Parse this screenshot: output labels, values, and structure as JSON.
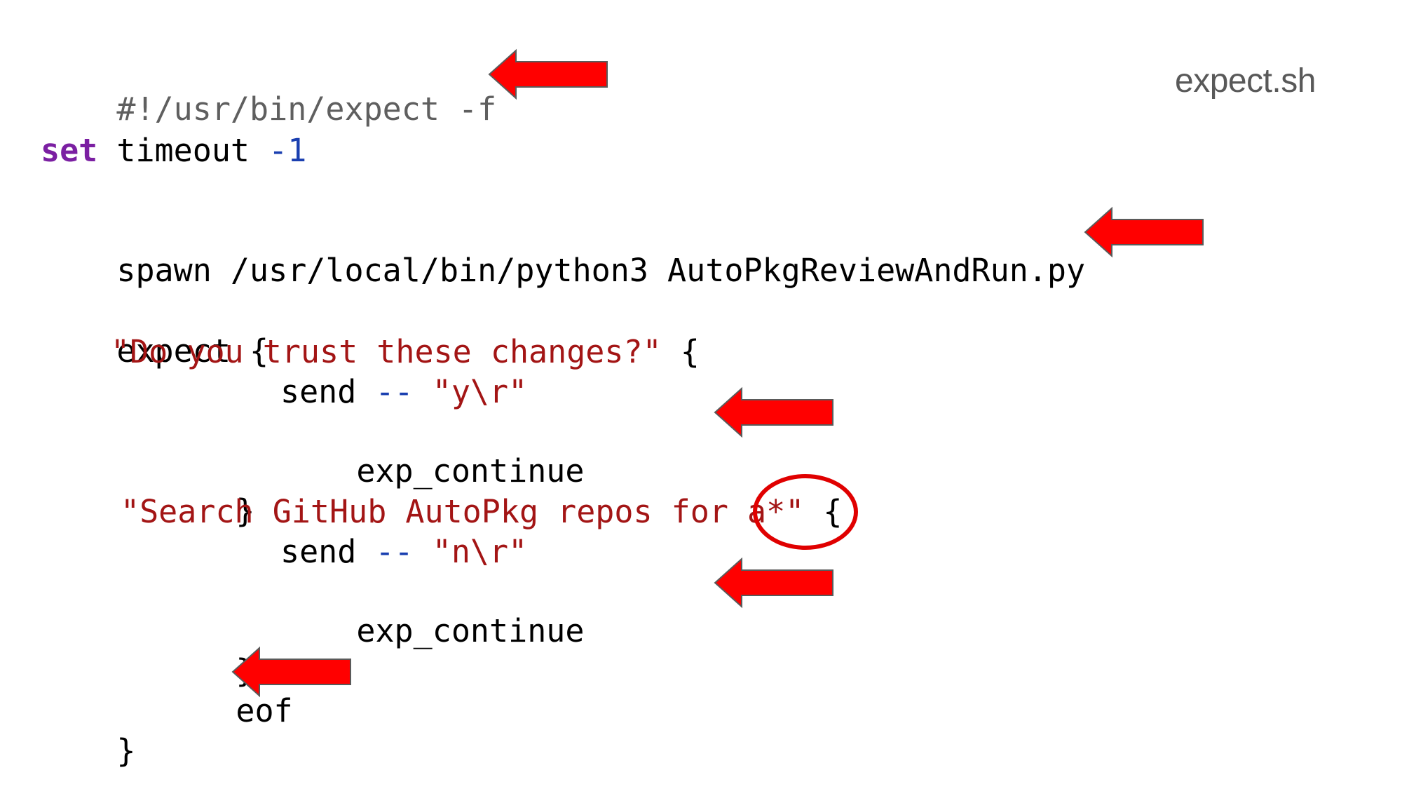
{
  "file_title": "expect.sh",
  "code": {
    "shebang": "#!/usr/bin/expect -f",
    "set_keyword": "set",
    "set_rest": " timeout ",
    "set_value": "-1",
    "spawn_line": "spawn /usr/local/bin/python3 AutoPkgReviewAndRun.py",
    "expect_open": "expect {",
    "prompt1_string": "\"Do you trust these changes?\"",
    "prompt1_brace": " {",
    "send1_cmd": "send ",
    "send1_op": "--",
    "send1_arg": "\"y\\r\"",
    "continue1": "exp_continue",
    "close1": "}",
    "prompt2_string": "\"Search GitHub AutoPkg repos for a*\"",
    "prompt2_brace": " {",
    "send2_cmd": "send ",
    "send2_op": "--",
    "send2_arg": "\"n\\r\"",
    "continue2": "exp_continue",
    "close2": "}",
    "eof": "eof",
    "expect_close": "}"
  },
  "annotation_colors": {
    "arrow_fill": "#ff0000",
    "arrow_stroke": "#5a5a5a",
    "circle_stroke": "#e00000"
  }
}
